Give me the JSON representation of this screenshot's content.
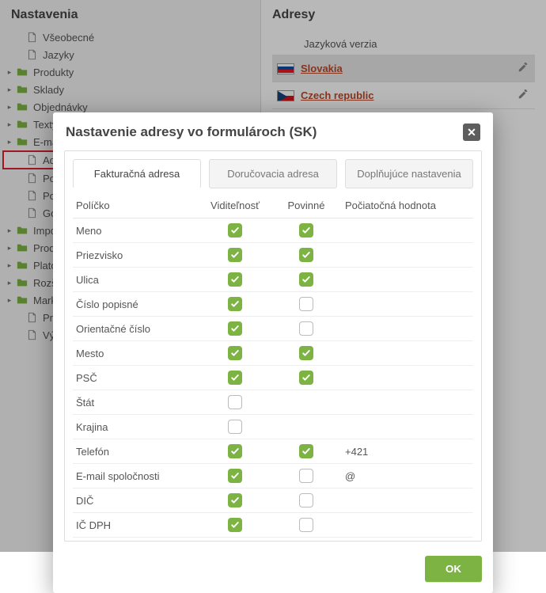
{
  "sidebar": {
    "title": "Nastavenia",
    "items": [
      {
        "label": "Všeobecné",
        "icon": "file",
        "expandable": false,
        "indent": true,
        "highlight": false
      },
      {
        "label": "Jazyky",
        "icon": "file",
        "expandable": false,
        "indent": true,
        "highlight": false
      },
      {
        "label": "Produkty",
        "icon": "folder",
        "expandable": true,
        "indent": false,
        "highlight": false
      },
      {
        "label": "Sklady",
        "icon": "folder",
        "expandable": true,
        "indent": false,
        "highlight": false
      },
      {
        "label": "Objednávky",
        "icon": "folder",
        "expandable": true,
        "indent": false,
        "highlight": false
      },
      {
        "label": "Texty a šablóny",
        "icon": "folder",
        "expandable": true,
        "indent": false,
        "highlight": false
      },
      {
        "label": "E-maily a SMS",
        "icon": "folder",
        "expandable": true,
        "indent": false,
        "highlight": false
      },
      {
        "label": "Adresy",
        "icon": "file",
        "expandable": false,
        "indent": true,
        "highlight": true
      },
      {
        "label": "Pohľady",
        "icon": "file",
        "expandable": false,
        "indent": true,
        "highlight": false
      },
      {
        "label": "Pobočky",
        "icon": "file",
        "expandable": false,
        "indent": true,
        "highlight": false
      },
      {
        "label": "Google Analytics",
        "icon": "file",
        "expandable": false,
        "indent": true,
        "highlight": false
      },
      {
        "label": "Import / Export",
        "icon": "folder",
        "expandable": true,
        "indent": false,
        "highlight": false
      },
      {
        "label": "Produktové portály",
        "icon": "folder",
        "expandable": true,
        "indent": false,
        "highlight": false
      },
      {
        "label": "Platobné brány",
        "icon": "folder",
        "expandable": true,
        "indent": false,
        "highlight": false
      },
      {
        "label": "Rozšírené možnosti",
        "icon": "folder",
        "expandable": true,
        "indent": false,
        "highlight": false
      },
      {
        "label": "Marketing a PR",
        "icon": "folder",
        "expandable": true,
        "indent": false,
        "highlight": false
      },
      {
        "label": "Presmerovania",
        "icon": "file",
        "expandable": false,
        "indent": true,
        "highlight": false
      },
      {
        "label": "Výhodné ponuky",
        "icon": "file",
        "expandable": false,
        "indent": true,
        "highlight": false
      }
    ]
  },
  "main": {
    "title": "Adresy",
    "lang_header": "Jazyková verzia",
    "languages": [
      {
        "name": "Slovakia",
        "flag": "sk",
        "selected": true
      },
      {
        "name": "Czech republic",
        "flag": "cz",
        "selected": false
      }
    ]
  },
  "modal": {
    "title": "Nastavenie adresy vo formulároch (SK)",
    "close": "✕",
    "ok": "OK",
    "tabs": [
      {
        "label": "Fakturačná adresa",
        "active": true
      },
      {
        "label": "Doručovacia adresa",
        "active": false
      },
      {
        "label": "Doplňujúce nastavenia",
        "active": false
      }
    ],
    "columns": {
      "field": "Políčko",
      "visibility": "Viditeľnosť",
      "required": "Povinné",
      "initial": "Počiatočná hodnota"
    },
    "rows": [
      {
        "field": "Meno",
        "visibility": true,
        "required": true,
        "initial": ""
      },
      {
        "field": "Priezvisko",
        "visibility": true,
        "required": true,
        "initial": ""
      },
      {
        "field": "Ulica",
        "visibility": true,
        "required": true,
        "initial": ""
      },
      {
        "field": "Číslo popisné",
        "visibility": true,
        "required": false,
        "initial": ""
      },
      {
        "field": "Orientačné číslo",
        "visibility": true,
        "required": false,
        "initial": ""
      },
      {
        "field": "Mesto",
        "visibility": true,
        "required": true,
        "initial": ""
      },
      {
        "field": "PSČ",
        "visibility": true,
        "required": true,
        "initial": ""
      },
      {
        "field": "Štát",
        "visibility": false,
        "required": null,
        "initial": ""
      },
      {
        "field": "Krajina",
        "visibility": false,
        "required": null,
        "initial": ""
      },
      {
        "field": "Telefón",
        "visibility": true,
        "required": true,
        "initial": "+421"
      },
      {
        "field": "E-mail spoločnosti",
        "visibility": true,
        "required": false,
        "initial": "@"
      },
      {
        "field": "DIČ",
        "visibility": true,
        "required": false,
        "initial": ""
      },
      {
        "field": "IČ DPH",
        "visibility": true,
        "required": false,
        "initial": ""
      }
    ]
  }
}
